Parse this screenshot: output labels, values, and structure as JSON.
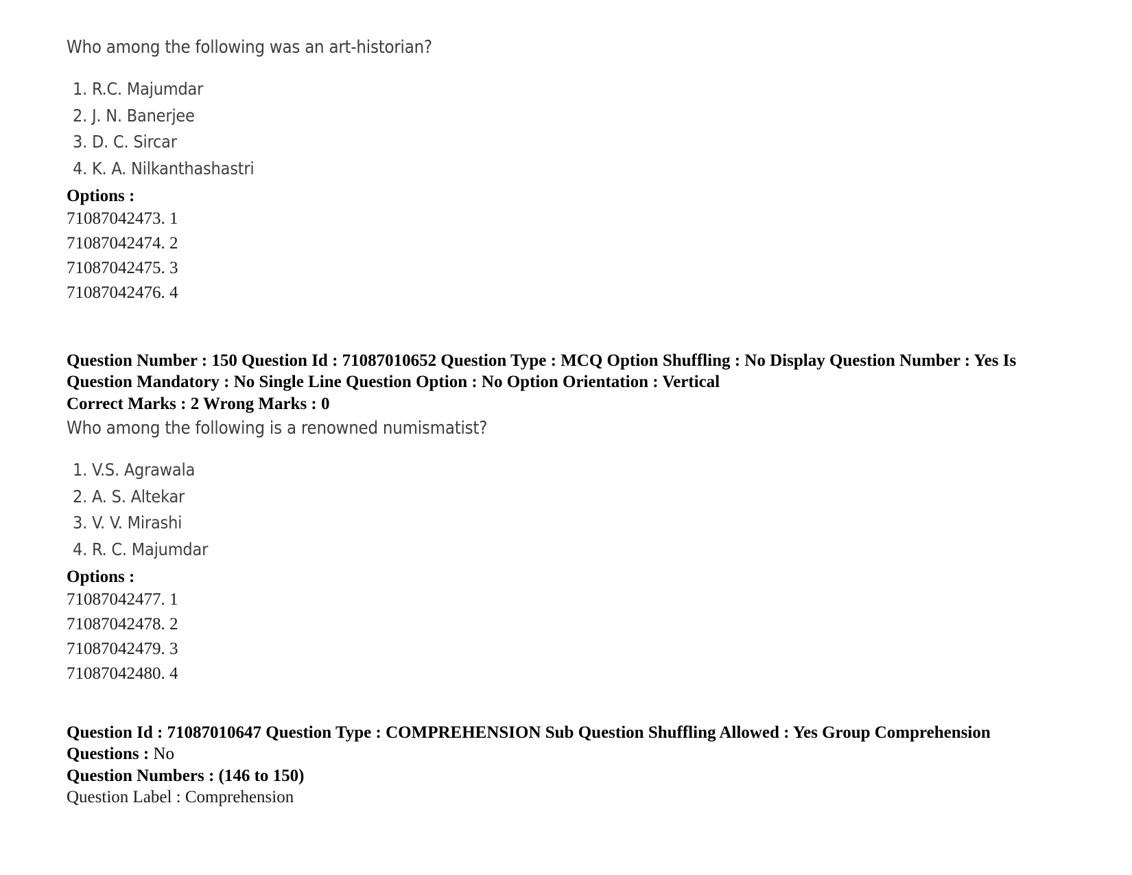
{
  "page": {
    "background_color": "#ffffff",
    "text_color": "#3d3d3d",
    "meta_color": "#000000"
  },
  "question_149": {
    "prompt": "Who among the following was an art-historian?",
    "choices": [
      "1. R.C. Majumdar",
      "2. J. N. Banerjee",
      "3. D. C. Sircar",
      "4. K. A. Nilkanthashastri"
    ],
    "options_label": "Options :",
    "option_ids": [
      "71087042473. 1",
      "71087042474. 2",
      "71087042475. 3",
      "71087042476. 4"
    ]
  },
  "question_150_meta": {
    "line1": "Question Number : 150 Question Id : 71087010652 Question Type : MCQ Option Shuffling : No Display Question Number : Yes Is Question Mandatory : No Single Line Question Option : No Option Orientation : Vertical",
    "line2": "Correct Marks : 2 Wrong Marks : 0"
  },
  "question_150": {
    "prompt": "Who among the following is a renowned numismatist?",
    "choices": [
      "1. V.S. Agrawala",
      "2. A. S. Altekar",
      "3. V. V. Mirashi",
      "4. R. C. Majumdar"
    ],
    "options_label": "Options :",
    "option_ids": [
      "71087042477. 1",
      "71087042478. 2",
      "71087042479. 3",
      "71087042480. 4"
    ]
  },
  "comprehension_block": {
    "line1_bold": "Question Id : 71087010647 Question Type : COMPREHENSION Sub Question Shuffling Allowed : Yes Group Comprehension Questions : ",
    "line1_plain": "No",
    "line2": "Question Numbers : (146 to 150)",
    "line3": "Question Label : Comprehension"
  }
}
